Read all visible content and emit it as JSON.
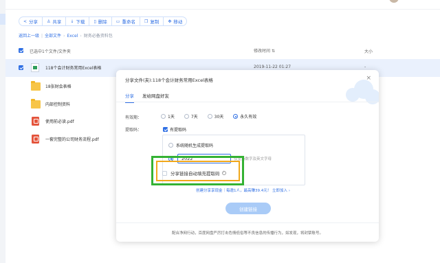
{
  "toolbar": {
    "buttons": [
      {
        "label": "分享",
        "icon": "share-icon"
      },
      {
        "label": "共享",
        "icon": "people-icon"
      },
      {
        "label": "下载",
        "icon": "download-icon"
      },
      {
        "label": "删除",
        "icon": "trash-icon"
      },
      {
        "label": "重命名",
        "icon": "rename-icon"
      },
      {
        "label": "复制",
        "icon": "copy-icon"
      },
      {
        "label": "移动",
        "icon": "move-icon"
      }
    ]
  },
  "breadcrumb": {
    "back": "返回上一级",
    "items": [
      "全部文件",
      "Excel",
      "财务必备资料包"
    ]
  },
  "list": {
    "selected_count": "已选中1个文件/文件夹",
    "col_modified": "修改时间",
    "col_size": "大小",
    "rows": [
      {
        "name": "118个会计财务常用Excel表格",
        "type": "excel",
        "date": "2019-11-22 01:27",
        "size": "-",
        "selected": true
      },
      {
        "name": "18张财会表格",
        "type": "folder",
        "date": "",
        "size": "",
        "selected": false
      },
      {
        "name": "内部控制资料",
        "type": "folder",
        "date": "",
        "size": "",
        "selected": false
      },
      {
        "name": "使用前必读.pdf",
        "type": "pdf",
        "date": "",
        "size": "",
        "selected": false
      },
      {
        "name": "一套完整的公司财务流程.pdf",
        "type": "pdf",
        "date": "",
        "size": "",
        "selected": false
      }
    ]
  },
  "modal": {
    "title": "分享文件(夹):118个会计财务常用Excel表格",
    "close_icon": "close-icon",
    "tabs": [
      "分享",
      "发给网盘好友"
    ],
    "active_tab": 0,
    "validity_label": "有效期：",
    "validity_options": [
      "1天",
      "7天",
      "30天",
      "永久有效"
    ],
    "validity_selected": 3,
    "code_label": "提取码：",
    "has_code_label": "有提取码",
    "system_code_label": "系统随机生成提取码",
    "custom_code_value": "2022",
    "custom_code_hint": "仅支持数字及英文字母",
    "autofill_label": "分享链接自动填充提取码",
    "promo_prefix": "创建分享享现金｜每邀1人，最高赚39.4元！",
    "promo_link": "立即加入 ›",
    "create_button": "创建链接",
    "footer_note": "配合净网行动，百度网盘严厉打击色情低俗等不良信息的传播行为，如发现，将封禁账号。"
  },
  "colors": {
    "accent": "#2f6fe4",
    "highlight_green": "#34b233",
    "highlight_orange": "#f1a81b"
  }
}
